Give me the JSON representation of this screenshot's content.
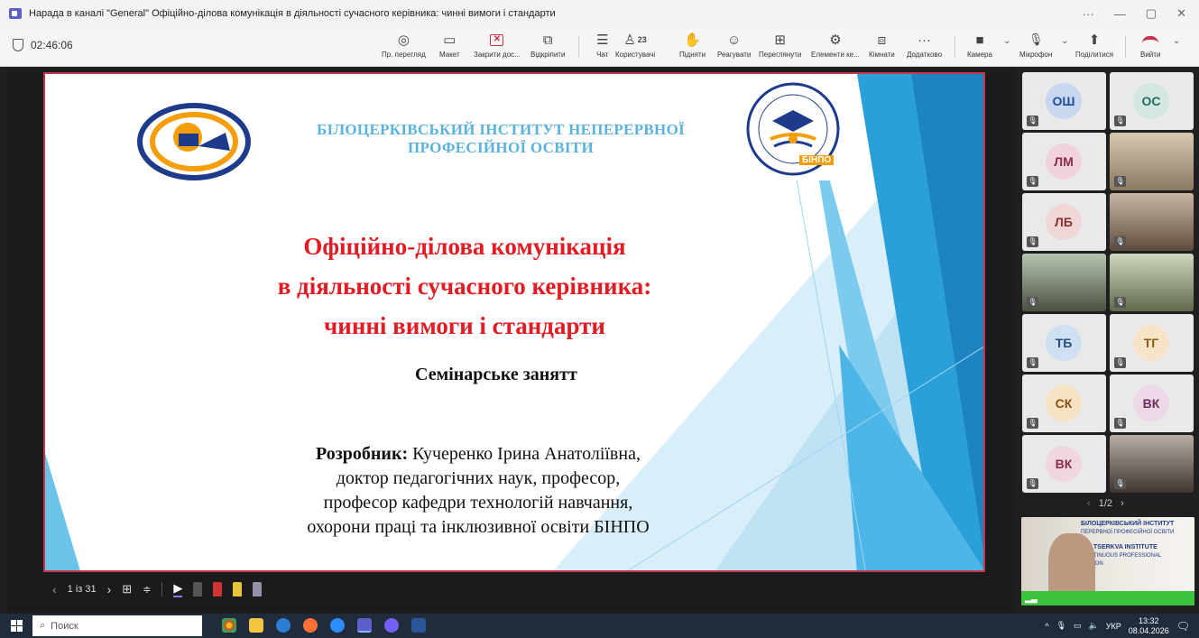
{
  "window": {
    "title": "Нарада в каналі \"General\" Офіційно-ділова комунікація в діяльності сучасного керівника: чинні вимоги і стандарти",
    "controls": [
      "···",
      "—",
      "▢",
      "✕"
    ]
  },
  "toolbar": {
    "timer": "02:46:06",
    "buttons": [
      {
        "label": "Пр. перегляд",
        "icon": "eye-icon",
        "glyph": "◎"
      },
      {
        "label": "Макет",
        "icon": "layout-icon",
        "glyph": "▭"
      },
      {
        "label": "Закрити дос...",
        "icon": "close-share-icon",
        "glyph": "✕"
      },
      {
        "label": "Відкріпити",
        "icon": "popout-icon",
        "glyph": "⧉"
      },
      {
        "label": "Чат",
        "icon": "chat-icon",
        "glyph": "☰"
      },
      {
        "label": "Користувачі",
        "icon": "people-icon",
        "glyph": "♙",
        "badge": "23"
      },
      {
        "label": "Підняти",
        "icon": "raise-hand-icon",
        "glyph": "✋"
      },
      {
        "label": "Реагувати",
        "icon": "react-icon",
        "glyph": "☺"
      },
      {
        "label": "Переглянути",
        "icon": "view-icon",
        "glyph": "⊞"
      },
      {
        "label": "Елементи ке...",
        "icon": "apps-icon",
        "glyph": "⚙"
      },
      {
        "label": "Кімнати",
        "icon": "rooms-icon",
        "glyph": "⧈"
      },
      {
        "label": "Додатково",
        "icon": "more-icon",
        "glyph": "···"
      },
      {
        "label": "Камера",
        "icon": "camera-icon",
        "glyph": "■"
      },
      {
        "label": "Мікрофон",
        "icon": "mic-icon",
        "glyph": "🎙"
      },
      {
        "label": "Поділитися",
        "icon": "share-icon",
        "glyph": "⬆"
      },
      {
        "label": "Вийти",
        "icon": "leave-icon",
        "glyph": ""
      }
    ]
  },
  "slide": {
    "institute": "БІЛОЦЕРКІВСЬКИЙ ІНСТИТУТ НЕПЕРЕРВНОЇ ПРОФЕСІЙНОЇ ОСВІТИ",
    "logo_text": "БІНПО",
    "title_lines": [
      "Офіційно-ділова комунікація",
      "в діяльності сучасного керівника:",
      "чинні вимоги і стандарти"
    ],
    "subtitle": "Семінарське занятт",
    "author_label": "Розробник:",
    "author_name": "Кучеренко Ірина Анатоліївна,",
    "author_lines": [
      "доктор педагогічних наук, професор,",
      "професор кафедри технологій навчання,",
      "охорони праці та інклюзивної освіти БІНПО"
    ],
    "colors": {
      "title": "#e31b23",
      "institute": "#5bb3dd",
      "accent_blue": "#2a9fd8"
    }
  },
  "slide_controls": {
    "counter": "1 із 31",
    "prev": "‹",
    "next": "›"
  },
  "participants": [
    {
      "initials": "ОШ",
      "video": false
    },
    {
      "initials": "ОС",
      "video": false
    },
    {
      "initials": "ЛМ",
      "video": false
    },
    {
      "initials": "",
      "video": true
    },
    {
      "initials": "ЛБ",
      "video": false
    },
    {
      "initials": "",
      "video": true
    },
    {
      "initials": "",
      "video": true
    },
    {
      "initials": "",
      "video": true
    },
    {
      "initials": "ТБ",
      "video": false
    },
    {
      "initials": "ТГ",
      "video": false
    },
    {
      "initials": "СК",
      "video": false
    },
    {
      "initials": "ВК",
      "video": false
    },
    {
      "initials": "ВК",
      "video": false
    },
    {
      "initials": "",
      "video": true
    }
  ],
  "pager": "1/2",
  "selfview": {
    "line1": "БІЛОЦЕРКІВСЬКИЙ ІНСТИТУТ",
    "line2": "ПЕРЕРВНОЇ ПРОФЕСІЙНОЇ ОСВІТИ",
    "line3": "TSERKVA INSTITUTE",
    "line4": "TINUOUS PROFESSIONAL",
    "line5": "ION"
  },
  "taskbar": {
    "search_placeholder": "Поиск",
    "lang": "УКР",
    "time": "13:32",
    "date": "08.04.2026"
  }
}
